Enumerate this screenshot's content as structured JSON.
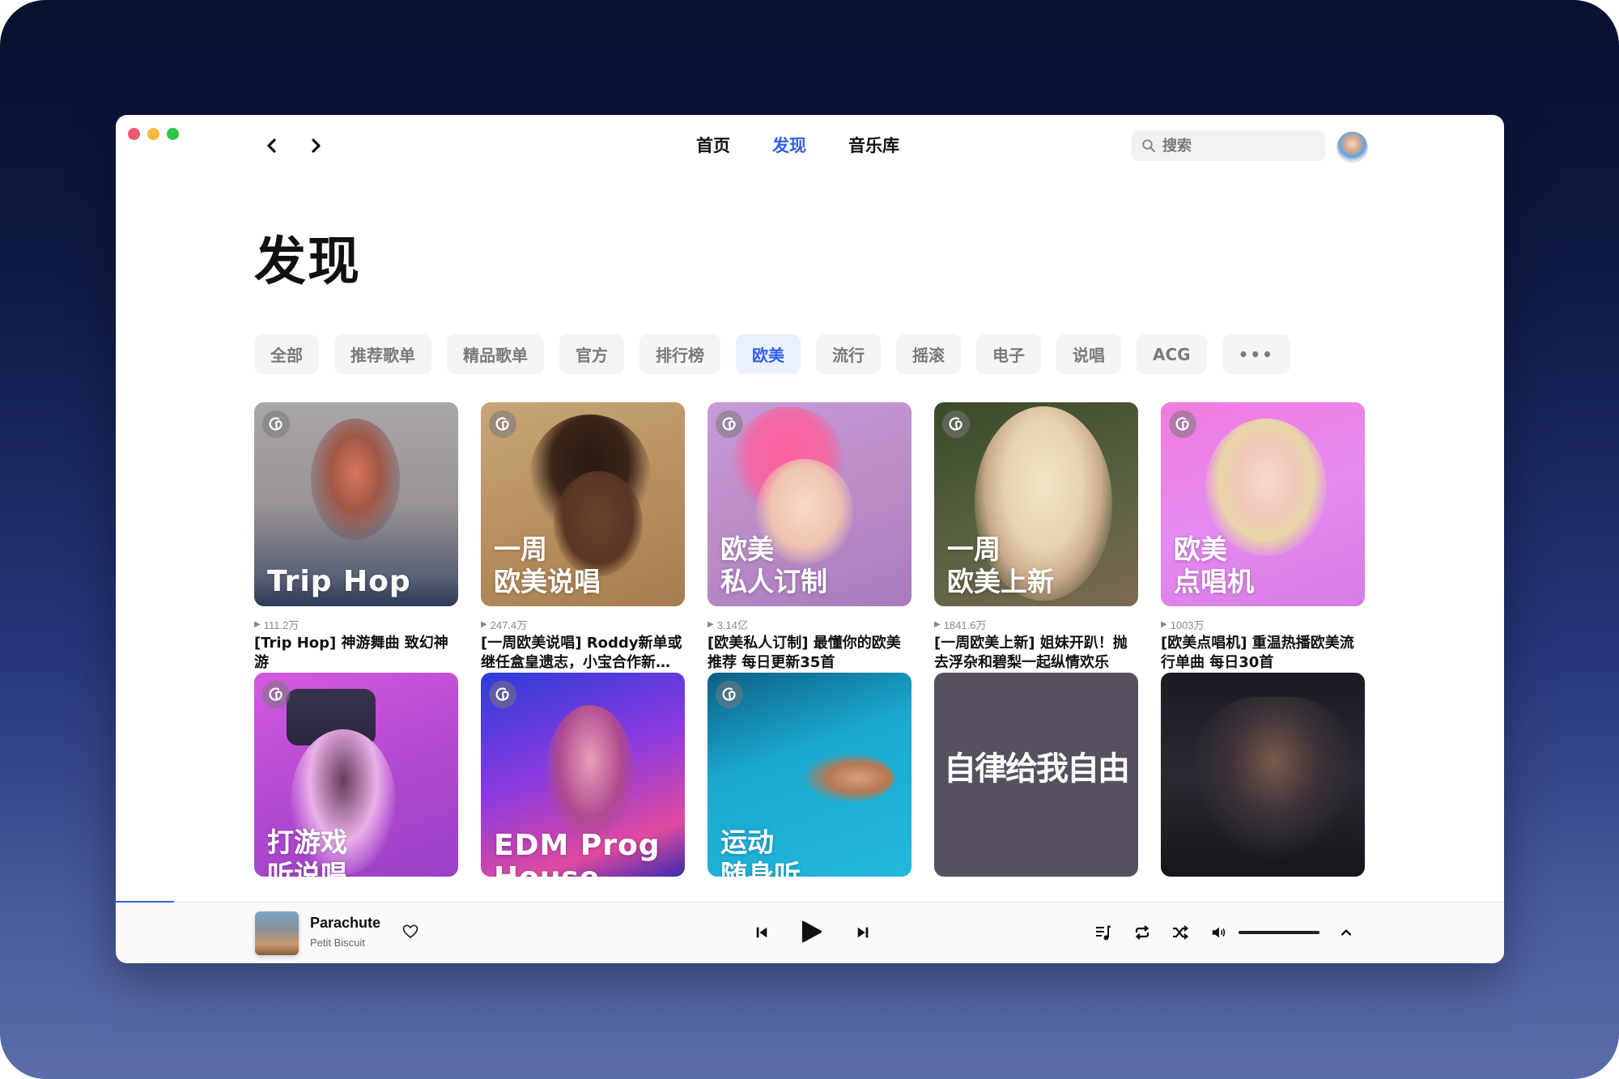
{
  "window": {
    "traffic_lights": [
      "close",
      "minimize",
      "maximize"
    ]
  },
  "nav": {
    "back_icon": "chevron-left-icon",
    "forward_icon": "chevron-right-icon",
    "tabs": [
      {
        "label": "首页",
        "active": false
      },
      {
        "label": "发现",
        "active": true
      },
      {
        "label": "音乐库",
        "active": false
      }
    ],
    "search_placeholder": "搜索",
    "search_value": "",
    "accent_color": "#335eea"
  },
  "page": {
    "title": "发现"
  },
  "categories": [
    {
      "label": "全部",
      "active": false
    },
    {
      "label": "推荐歌单",
      "active": false
    },
    {
      "label": "精品歌单",
      "active": false
    },
    {
      "label": "官方",
      "active": false
    },
    {
      "label": "排行榜",
      "active": false
    },
    {
      "label": "欧美",
      "active": true
    },
    {
      "label": "流行",
      "active": false
    },
    {
      "label": "摇滚",
      "active": false
    },
    {
      "label": "电子",
      "active": false
    },
    {
      "label": "说唱",
      "active": false
    },
    {
      "label": "ACG",
      "active": false
    },
    {
      "label": "•••",
      "active": false
    }
  ],
  "playlists_row1": [
    {
      "overlay": [
        "Trip Hop"
      ],
      "plays": "111.2万",
      "title": "[Trip Hop] 神游舞曲 致幻神游"
    },
    {
      "overlay": [
        "一周",
        "欧美说唱"
      ],
      "plays": "247.4万",
      "title": "[一周欧美说唱] Roddy新单或继任盒皇遗志，小宝合作新…"
    },
    {
      "overlay": [
        "欧美",
        "私人订制"
      ],
      "plays": "3.14亿",
      "title": "[欧美私人订制] 最懂你的欧美推荐 每日更新35首"
    },
    {
      "overlay": [
        "一周",
        "欧美上新"
      ],
      "plays": "1841.6万",
      "title": "[一周欧美上新] 姐妹开趴！抛去浮杂和碧梨一起纵情欢乐"
    },
    {
      "overlay": [
        "欧美",
        "点唱机"
      ],
      "plays": "1003万",
      "title": "[欧美点唱机] 重温热播欧美流行单曲 每日30首"
    }
  ],
  "playlists_row2": [
    {
      "overlay": [
        "打游戏",
        "听说唱"
      ],
      "has_badge": true
    },
    {
      "overlay": [
        "EDM Prog",
        "House"
      ],
      "has_badge": true
    },
    {
      "overlay": [
        "运动",
        "随身听"
      ],
      "has_badge": true
    },
    {
      "center_text": "自律给我自由",
      "has_badge": false
    },
    {
      "overlay": [],
      "has_badge": false
    }
  ],
  "player": {
    "song": "Parachute",
    "artist": "Petit Biscuit",
    "progress_fraction": 0.042,
    "volume_fraction": 1.0,
    "controls": [
      "previous-icon",
      "play-icon",
      "next-icon"
    ],
    "right_controls": [
      "playlist-icon",
      "repeat-icon",
      "shuffle-icon",
      "volume-icon",
      "chevron-up-icon"
    ]
  }
}
